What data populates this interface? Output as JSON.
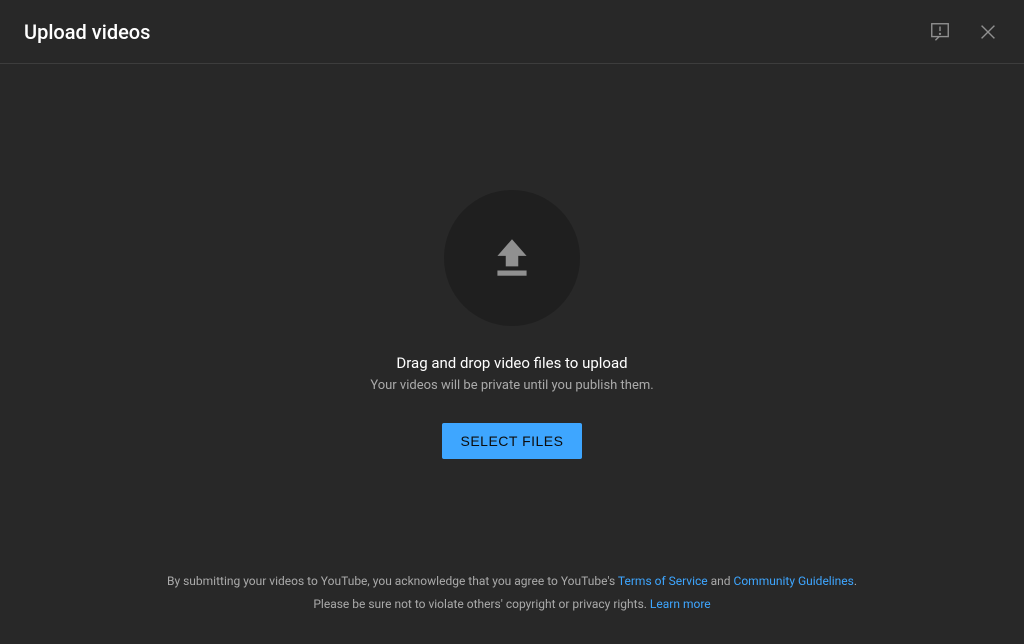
{
  "header": {
    "title": "Upload videos"
  },
  "main": {
    "drag_text": "Drag and drop video files to upload",
    "private_text": "Your videos will be private until you publish them.",
    "select_button": "SELECT FILES"
  },
  "footer": {
    "line1_part1": "By submitting your videos to YouTube, you acknowledge that you agree to YouTube's ",
    "terms_link": "Terms of Service",
    "line1_part2": " and ",
    "guidelines_link": "Community Guidelines",
    "line1_part3": ".",
    "line2_part1": "Please be sure not to violate others' copyright or privacy rights. ",
    "learn_more_link": "Learn more"
  }
}
